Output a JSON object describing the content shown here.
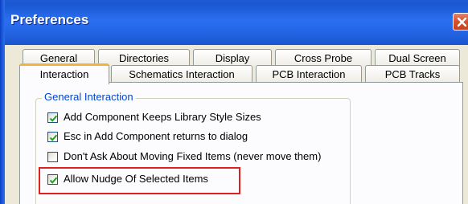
{
  "window": {
    "title": "Preferences"
  },
  "tabs_row1": [
    {
      "label": "General"
    },
    {
      "label": "Directories"
    },
    {
      "label": "Display"
    },
    {
      "label": "Cross Probe"
    },
    {
      "label": "Dual Screen"
    }
  ],
  "tabs_row2": [
    {
      "label": "Interaction",
      "active": true
    },
    {
      "label": "Schematics Interaction"
    },
    {
      "label": "PCB Interaction"
    },
    {
      "label": "PCB Tracks"
    }
  ],
  "group": {
    "label": "General Interaction",
    "options": [
      {
        "label": "Add Component Keeps Library Style Sizes",
        "checked": true
      },
      {
        "label": "Esc in Add Component returns to dialog",
        "checked": true
      },
      {
        "label": "Don't Ask About Moving Fixed Items (never move them)",
        "checked": false
      },
      {
        "label": "Allow Nudge Of Selected Items",
        "checked": true
      }
    ]
  },
  "colors": {
    "titlebar": "#2465e6",
    "group_label": "#0046d5",
    "highlight": "#e02020",
    "active_tab_accent": "#f2b33c"
  }
}
